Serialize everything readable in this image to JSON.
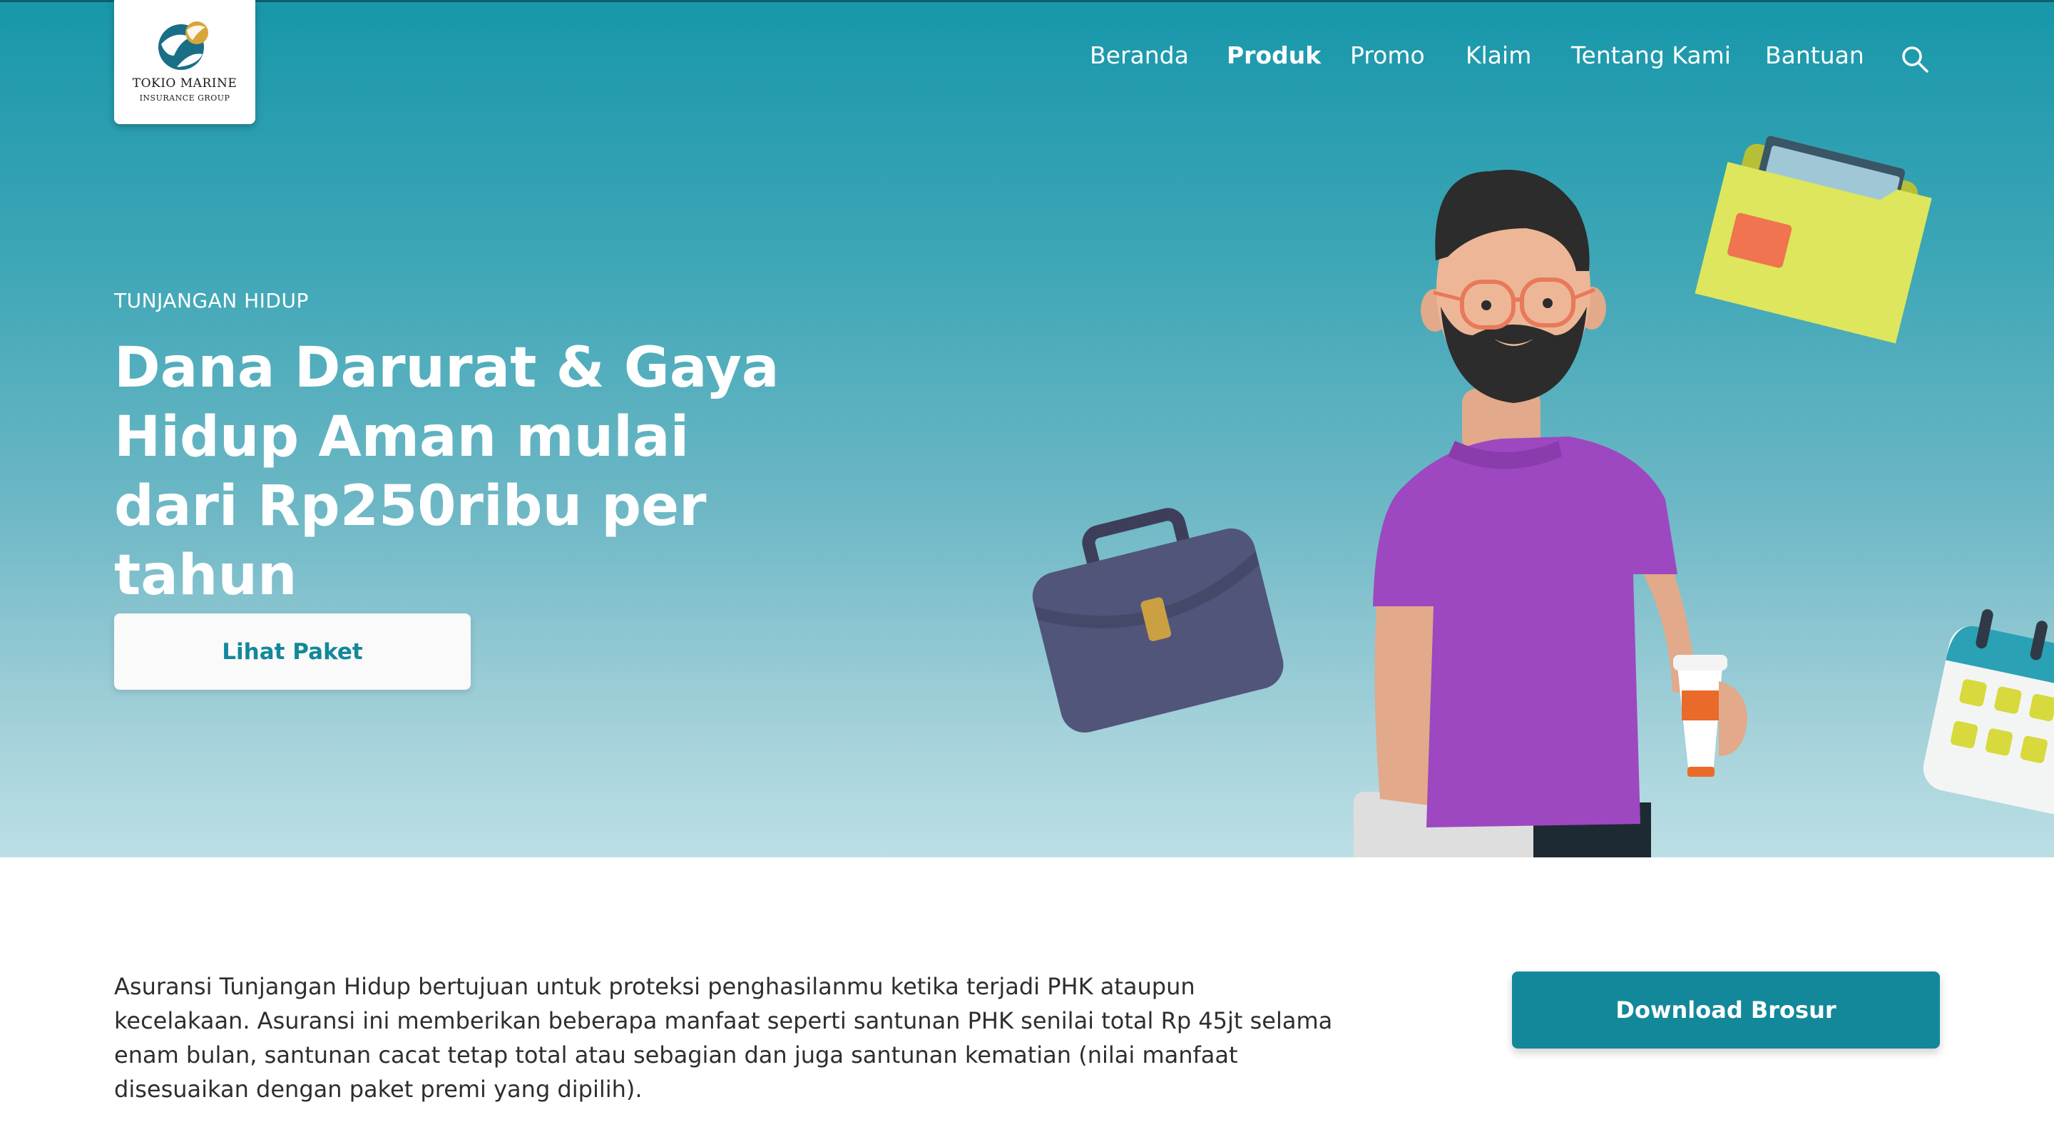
{
  "brand": {
    "name": "TOKIO MARINE",
    "subtitle": "INSURANCE GROUP"
  },
  "nav": {
    "items": [
      {
        "label": "Beranda",
        "active": false
      },
      {
        "label": "Produk",
        "active": true
      },
      {
        "label": "Promo",
        "active": false
      },
      {
        "label": "Klaim",
        "active": false
      },
      {
        "label": "Tentang Kami",
        "active": false
      },
      {
        "label": "Bantuan",
        "active": false
      }
    ],
    "search_icon": "search-icon"
  },
  "hero": {
    "eyebrow": "TUNJANGAN HIDUP",
    "title": "Dana Darurat & Gaya Hidup Aman mulai dari Rp250ribu per tahun",
    "cta_label": "Lihat Paket",
    "illustration_icons": [
      "person-illustration",
      "briefcase-icon",
      "folder-icon",
      "calendar-icon",
      "coffee-cup-icon"
    ]
  },
  "content": {
    "description": "Asuransi Tunjangan Hidup bertujuan untuk proteksi penghasilanmu ketika terjadi PHK ataupun kecelakaan. Asuransi ini memberikan beberapa manfaat seperti santunan PHK senilai total Rp 45jt selama enam bulan, santunan cacat tetap total atau sebagian dan juga santunan kematian (nilai manfaat disesuaikan dengan paket premi yang dipilih).",
    "download_label": "Download Brosur"
  },
  "colors": {
    "primary": "#13889a",
    "hero_top": "#1797aa",
    "hero_bottom": "#bcdfe5",
    "text_dark": "#2e2e2e"
  }
}
